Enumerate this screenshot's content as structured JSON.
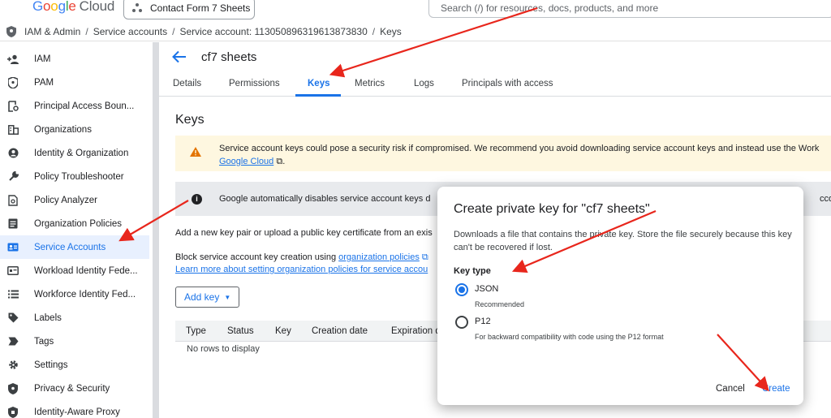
{
  "header": {
    "logo_letters": [
      "G",
      "o",
      "o",
      "g",
      "l",
      "e"
    ],
    "logo_suffix": "Cloud",
    "project": "Contact Form 7 Sheets",
    "search_placeholder": "Search (/) for resources, docs, products, and more"
  },
  "breadcrumb": [
    "IAM & Admin",
    "Service accounts",
    "Service account: 113050896319613873830",
    "Keys"
  ],
  "sidebar": {
    "items": [
      {
        "label": "IAM",
        "icon": "person-add-icon"
      },
      {
        "label": "PAM",
        "icon": "shield-icon"
      },
      {
        "label": "Principal Access Boun...",
        "icon": "access-boundary-icon"
      },
      {
        "label": "Organizations",
        "icon": "organizations-icon"
      },
      {
        "label": "Identity & Organization",
        "icon": "identity-icon"
      },
      {
        "label": "Policy Troubleshooter",
        "icon": "wrench-icon"
      },
      {
        "label": "Policy Analyzer",
        "icon": "policy-analyzer-icon"
      },
      {
        "label": "Organization Policies",
        "icon": "org-policies-icon"
      },
      {
        "label": "Service Accounts",
        "icon": "service-account-icon",
        "active": true
      },
      {
        "label": "Workload Identity Fede...",
        "icon": "workload-identity-icon"
      },
      {
        "label": "Workforce Identity Fed...",
        "icon": "workforce-identity-icon"
      },
      {
        "label": "Labels",
        "icon": "label-icon"
      },
      {
        "label": "Tags",
        "icon": "tag-icon"
      },
      {
        "label": "Settings",
        "icon": "gear-icon"
      },
      {
        "label": "Privacy & Security",
        "icon": "privacy-icon"
      },
      {
        "label": "Identity-Aware Proxy",
        "icon": "iap-icon"
      }
    ]
  },
  "page": {
    "title": "cf7 sheets",
    "tabs": [
      {
        "label": "Details"
      },
      {
        "label": "Permissions"
      },
      {
        "label": "Keys",
        "active": true
      },
      {
        "label": "Metrics"
      },
      {
        "label": "Logs"
      },
      {
        "label": "Principals with access"
      }
    ],
    "section_title": "Keys",
    "warning_text": "Service account keys could pose a security risk if compromised. We recommend you avoid downloading service account keys and instead use the Work",
    "warning_link": "Google Cloud",
    "info_text": "Google automatically disables service account keys d",
    "info_text_right": "ccountK",
    "add_new_text": "Add a new key pair or upload a public key certificate from an exis",
    "block_text": "Block service account key creation using ",
    "block_link": "organization policies",
    "learn_more_link": "Learn more about setting organization policies for service accou",
    "add_key_label": "Add key",
    "table_headers": [
      "Type",
      "Status",
      "Key",
      "Creation date",
      "Expiration d"
    ],
    "no_rows": "No rows to display"
  },
  "modal": {
    "title": "Create private key for \"cf7 sheets\"",
    "description": "Downloads a file that contains the private key. Store the file securely because this key can't be recovered if lost.",
    "key_type_label": "Key type",
    "options": [
      {
        "label": "JSON",
        "help": "Recommended",
        "selected": true
      },
      {
        "label": "P12",
        "help": "For backward compatibility with code using the P12 format",
        "selected": false
      }
    ],
    "cancel_label": "Cancel",
    "create_label": "Create"
  },
  "colors": {
    "accent": "#1a73e8",
    "warning_bg": "#fef7e0",
    "annotation_arrow": "#e8261c"
  }
}
